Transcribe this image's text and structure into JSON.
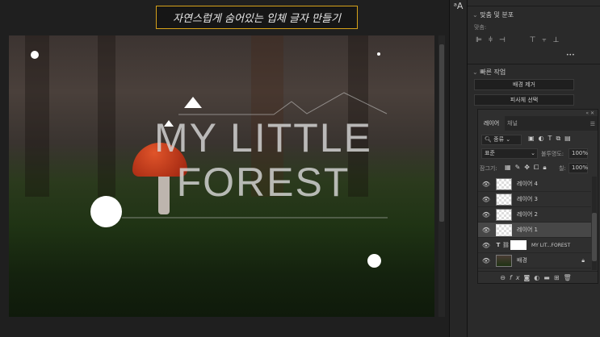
{
  "caption": "자연스럽게 숨어있는 입체 글자 만들기",
  "artwork": {
    "line1": "MY LITTLE",
    "line2": "FOREST"
  },
  "properties": {
    "align_section": "맞춤 및 분포",
    "align_label": "맞춤:",
    "more": "•••",
    "quick_section": "빠른 작업",
    "remove_bg": "배경 제거",
    "select_subject": "피사체 선택"
  },
  "layers_panel": {
    "tabs": [
      "레이어",
      "채널"
    ],
    "filter_kind": "종류",
    "blend_mode": "표준",
    "opacity_label": "불투명도:",
    "opacity_value": "100%",
    "lock_label": "잠그기:",
    "fill_label": "칠:",
    "fill_value": "100%",
    "layers": [
      {
        "name": "레이어 4",
        "selected": false
      },
      {
        "name": "레이어 3",
        "selected": false
      },
      {
        "name": "레이어 2",
        "selected": false
      },
      {
        "name": "레이어 1",
        "selected": true
      },
      {
        "name": "MY LIT...FOREST",
        "type": "text"
      },
      {
        "name": "배경",
        "type": "background",
        "locked": true
      }
    ]
  },
  "colors": {
    "caption_border": "#d6a21a",
    "selected_layer": "#474747"
  }
}
